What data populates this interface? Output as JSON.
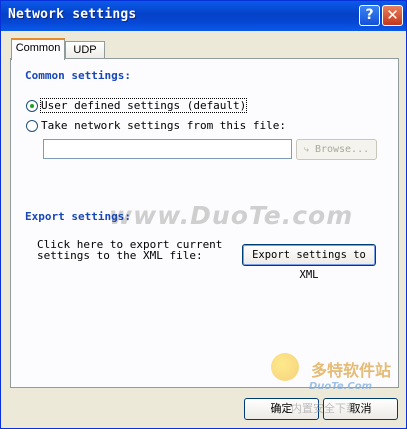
{
  "window": {
    "title": "Network settings"
  },
  "titlebar_buttons": {
    "help": "?",
    "close": "✕"
  },
  "tabs": [
    {
      "label": "Common",
      "active": true
    },
    {
      "label": "UDP",
      "active": false
    }
  ],
  "common_settings": {
    "heading": "Common settings:",
    "option_user_defined": "User defined settings (default)",
    "option_from_file": "Take network settings from this file:",
    "selected": "user_defined",
    "file_path_value": "",
    "browse_label": "Browse..."
  },
  "export_settings": {
    "heading": "Export settings:",
    "description_line1": "Click here to export current",
    "description_line2": "settings to the XML file:",
    "button_label": "Export settings to XML"
  },
  "footer": {
    "ok_label": "确定",
    "cancel_label": "取消"
  },
  "watermark": {
    "text": "www.DuoTe.com",
    "brand_cn": "多特软件站",
    "brand_en": "DuoTe.Com",
    "overlay_text": "内置安全下载"
  }
}
